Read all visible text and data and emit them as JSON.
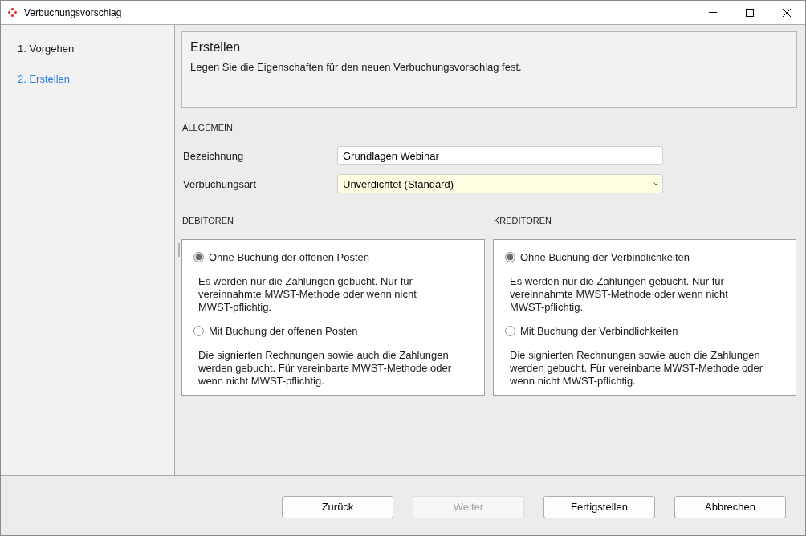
{
  "window": {
    "title": "Verbuchungsvorschlag"
  },
  "steps": [
    {
      "label": "1. Vorgehen",
      "selected": false
    },
    {
      "label": "2. Erstellen",
      "selected": true
    }
  ],
  "header": {
    "title": "Erstellen",
    "description": "Legen Sie die Eigenschaften für den neuen Verbuchungsvorschlag fest."
  },
  "general": {
    "heading": "ALLGEMEIN",
    "fields": [
      {
        "kind": "text",
        "label": "Bezeichnung",
        "value": "Grundlagen Webinar",
        "focused": false
      },
      {
        "kind": "select",
        "label": "Verbuchungsart",
        "value": "Unverdichtet (Standard)",
        "focused": true
      }
    ]
  },
  "groups": [
    {
      "heading": "DEBITOREN",
      "options": [
        {
          "label": "Ohne Buchung der offenen Posten",
          "description": "Es werden nur die Zahlungen gebucht. Nur für vereinnahmte MWST-Methode oder wenn nicht MWST-pflichtig.",
          "selected": true
        },
        {
          "label": "Mit Buchung der offenen Posten",
          "description": "Die signierten Rechnungen sowie auch die Zahlungen werden gebucht. Für vereinbarte MWST-Methode oder wenn nicht MWST-pflichtig.",
          "selected": false
        }
      ]
    },
    {
      "heading": "KREDITOREN",
      "options": [
        {
          "label": "Ohne Buchung der Verbindlichkeiten",
          "description": "Es werden nur die Zahlungen gebucht. Nur für vereinnahmte MWST-Methode oder wenn nicht MWST-pflichtig.",
          "selected": true
        },
        {
          "label": "Mit Buchung der Verbindlichkeiten",
          "description": "Die signierten Rechnungen sowie auch die Zahlungen werden gebucht. Für vereinbarte MWST-Methode oder wenn nicht MWST-pflichtig.",
          "selected": false
        }
      ]
    }
  ],
  "buttons": [
    {
      "label": "Zurück",
      "disabled": false
    },
    {
      "label": "Weiter",
      "disabled": true
    },
    {
      "label": "Fertigstellen",
      "disabled": false
    },
    {
      "label": "Abbrechen",
      "disabled": false
    }
  ]
}
